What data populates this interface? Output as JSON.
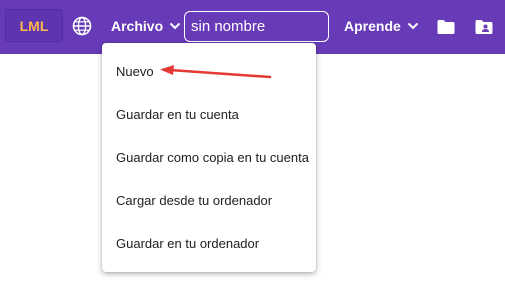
{
  "app": {
    "logo_text": "LML",
    "brand_color": "#673ab7",
    "logo_text_color": "#ffb74d"
  },
  "header": {
    "language_icon": "globe-icon",
    "file_menu_label": "Archivo",
    "filename_value": "sin nombre",
    "learn_menu_label": "Aprende",
    "folder_icon": "folder-icon",
    "account_folder_icon": "account-folder-icon"
  },
  "file_menu": {
    "items": [
      {
        "label": "Nuevo"
      },
      {
        "label": "Guardar en tu cuenta"
      },
      {
        "label": "Guardar como copia en tu cuenta"
      },
      {
        "label": "Cargar desde tu ordenador"
      },
      {
        "label": "Guardar en tu ordenador"
      }
    ]
  },
  "annotation": {
    "arrow_color": "#e53935",
    "points_to": "Nuevo"
  }
}
